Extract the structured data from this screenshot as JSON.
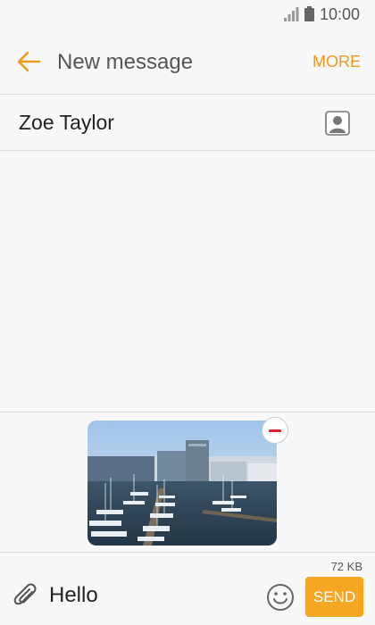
{
  "status_bar": {
    "time": "10:00"
  },
  "app_bar": {
    "title": "New message",
    "more_label": "MORE"
  },
  "recipient": {
    "name": "Zoe Taylor"
  },
  "attachment": {
    "type": "photo",
    "description_icon": "harbor-photo"
  },
  "compose": {
    "size_label": "72 KB",
    "message_text": "Hello",
    "send_label": "SEND"
  },
  "colors": {
    "accent": "#f19a1f",
    "send_button": "#f5a623",
    "remove": "#d9232d"
  },
  "icons": [
    "signal-icon",
    "battery-icon",
    "back-arrow-icon",
    "contact-icon",
    "remove-attachment-icon",
    "paperclip-icon",
    "emoji-icon"
  ]
}
